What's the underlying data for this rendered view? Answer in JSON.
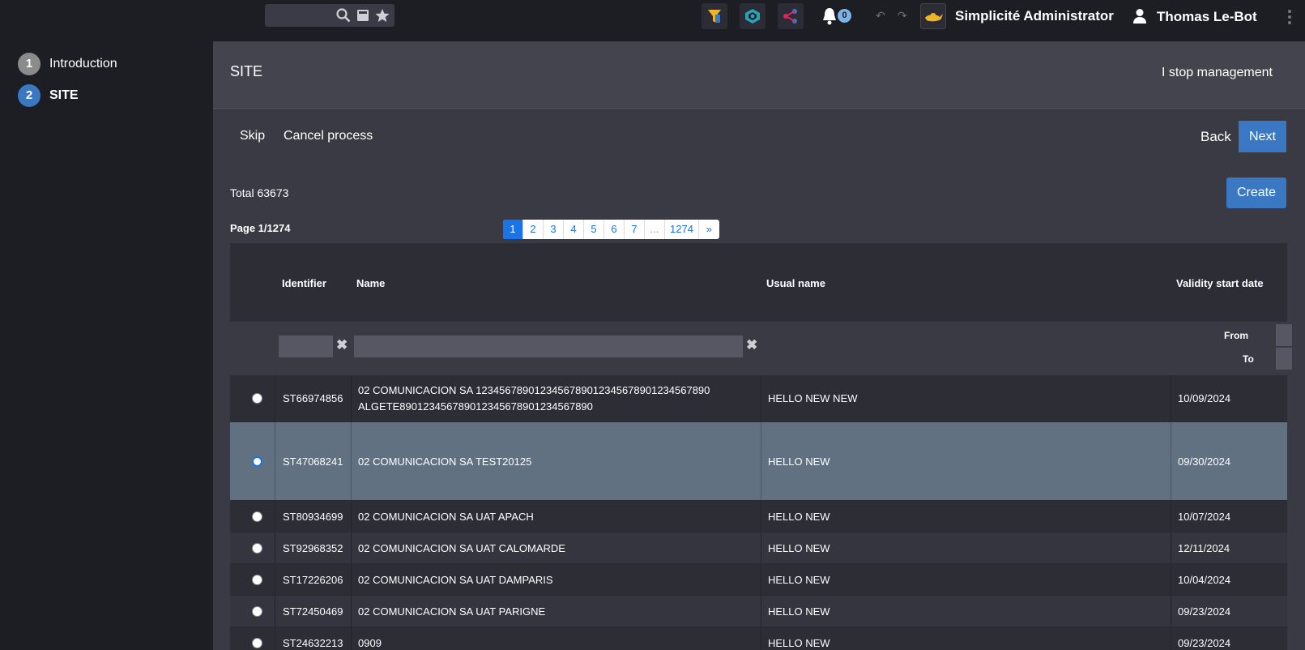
{
  "topbar": {
    "search_placeholder": "",
    "app_name": "Simplicité Administrator",
    "user_name": "Thomas Le-Bot",
    "notification_count": "0"
  },
  "steps": [
    {
      "number": "1",
      "label": "Introduction"
    },
    {
      "number": "2",
      "label": "SITE"
    }
  ],
  "header": {
    "title": "SITE",
    "stop_label": "I stop management"
  },
  "actions": {
    "skip": "Skip",
    "cancel": "Cancel process",
    "back": "Back",
    "next": "Next",
    "create": "Create"
  },
  "list": {
    "total": "Total 63673",
    "page_info": "Page 1/1274",
    "pages": [
      "1",
      "2",
      "3",
      "4",
      "5",
      "6",
      "7",
      "...",
      "1274",
      "»"
    ],
    "columns": [
      "Identifier",
      "Name",
      "Usual name",
      "Validity start date"
    ],
    "filter_from": "From",
    "filter_to": "To",
    "rows": [
      {
        "id": "ST66974856",
        "name": "02 COMUNICACION SA 1234567890123456789012345678901234567890 ALGETE890123456789012345678901234567890",
        "usual": "HELLO NEW NEW",
        "date": "10/09/2024"
      },
      {
        "id": "ST47068241",
        "name": "02 COMUNICACION SA TEST20125",
        "usual": "HELLO NEW",
        "date": "09/30/2024"
      },
      {
        "id": "ST80934699",
        "name": "02 COMUNICACION SA UAT APACH",
        "usual": "HELLO NEW",
        "date": "10/07/2024"
      },
      {
        "id": "ST92968352",
        "name": "02 COMUNICACION SA UAT CALOMARDE",
        "usual": "HELLO NEW",
        "date": "12/11/2024"
      },
      {
        "id": "ST17226206",
        "name": "02 COMUNICACION SA UAT DAMPARIS",
        "usual": "HELLO NEW",
        "date": "10/04/2024"
      },
      {
        "id": "ST72450469",
        "name": "02 COMUNICACION SA UAT PARIGNE",
        "usual": "HELLO NEW",
        "date": "09/23/2024"
      },
      {
        "id": "ST24632213",
        "name": "0909",
        "usual": "HELLO NEW",
        "date": "09/23/2024"
      }
    ]
  }
}
